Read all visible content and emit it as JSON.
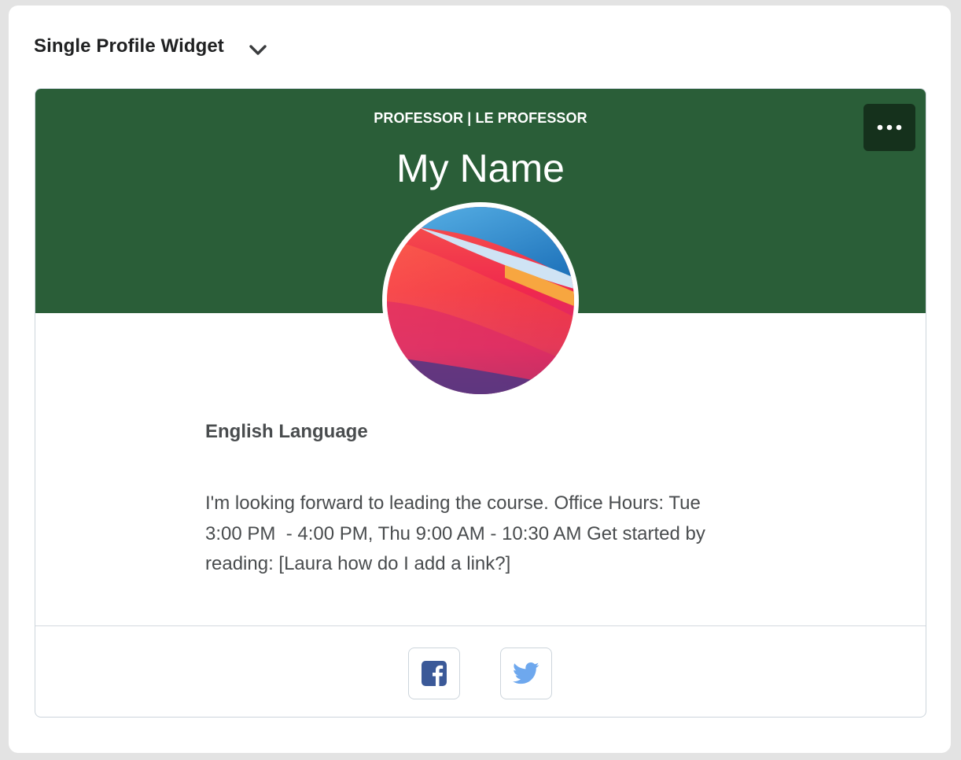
{
  "widget": {
    "title": "Single Profile Widget",
    "toggle_icon": "chevron-down-icon"
  },
  "profile": {
    "role": "PROFESSOR | LE PROFESSOR",
    "name": "My Name",
    "department": "English Language",
    "bio": "I'm looking forward to leading the course. Office Hours: Tue\n3:00 PM  - 4:00 PM, Thu 9:00 AM - 10:30 AM Get started by\nreading: [Laura how do I add a link?]",
    "more_icon": "more-options-icon",
    "more_label": "•••"
  },
  "social": {
    "facebook_icon": "facebook-icon",
    "twitter_icon": "twitter-icon"
  },
  "colors": {
    "banner": "#2a5e38",
    "more_button": "#15311c",
    "facebook": "#3b5998",
    "twitter": "#6ea8ee",
    "text": "#494c4e"
  }
}
